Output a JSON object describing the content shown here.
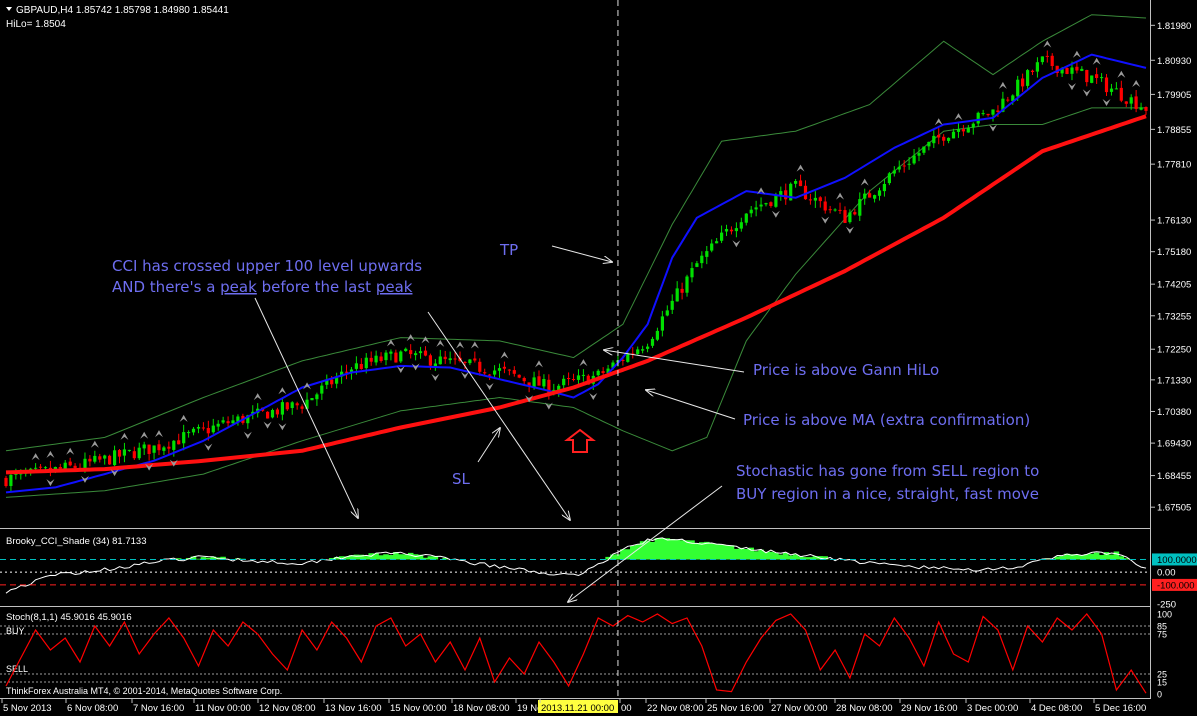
{
  "window": {
    "symbol_line": "GBPAUD,H4  1.85742 1.85798 1.84980 1.85441",
    "hilo_line": "HiLo= 1.8504"
  },
  "colors": {
    "background": "#000000",
    "bull": "#00e000",
    "bear": "#ff0000",
    "hilo": "#1010ff",
    "ma": "#ff1010",
    "bands": "#3a8a3a",
    "annotation": "#6e6ef0",
    "cci_fill": "#33ff33",
    "stoch_line": "#ff0000"
  },
  "chart_data": [
    {
      "type": "candlestick",
      "title": "GBPAUD,H4",
      "ylim": [
        1.67,
        1.822
      ],
      "y_ticks": [
        "1.81980",
        "1.80930",
        "1.79905",
        "1.78855",
        "1.77810",
        "1.76130",
        "1.75180",
        "1.74205",
        "1.73255",
        "1.72250",
        "1.71330",
        "1.70380",
        "1.69430",
        "1.68455",
        "1.67505"
      ],
      "y_tick_values": [
        1.8198,
        1.8093,
        1.79905,
        1.78855,
        1.7781,
        1.7613,
        1.7518,
        1.74205,
        1.73255,
        1.7225,
        1.7133,
        1.7038,
        1.6943,
        1.68455,
        1.67505
      ],
      "candle_count": 232,
      "close_path": [
        [
          0,
          1.6835
        ],
        [
          15,
          1.6875
        ],
        [
          30,
          1.693
        ],
        [
          45,
          1.7005
        ],
        [
          60,
          1.706
        ],
        [
          70,
          1.717
        ],
        [
          80,
          1.721
        ],
        [
          90,
          1.7185
        ],
        [
          100,
          1.716
        ],
        [
          110,
          1.711
        ],
        [
          120,
          1.7145
        ],
        [
          130,
          1.725
        ],
        [
          140,
          1.748
        ],
        [
          150,
          1.764
        ],
        [
          160,
          1.771
        ],
        [
          170,
          1.762
        ],
        [
          180,
          1.776
        ],
        [
          190,
          1.787
        ],
        [
          200,
          1.794
        ],
        [
          210,
          1.809
        ],
        [
          220,
          1.804
        ],
        [
          231,
          1.795
        ]
      ],
      "series": [
        {
          "name": "HiLo",
          "points": [
            [
              0,
              1.6795
            ],
            [
              10,
              1.681
            ],
            [
              20,
              1.685
            ],
            [
              30,
              1.689
            ],
            [
              40,
              1.695
            ],
            [
              50,
              1.703
            ],
            [
              60,
              1.711
            ],
            [
              70,
              1.7155
            ],
            [
              80,
              1.7175
            ],
            [
              90,
              1.717
            ],
            [
              100,
              1.7135
            ],
            [
              110,
              1.71
            ],
            [
              115,
              1.708
            ],
            [
              120,
              1.712
            ],
            [
              125,
              1.72
            ],
            [
              130,
              1.73
            ],
            [
              135,
              1.75
            ],
            [
              140,
              1.762
            ],
            [
              150,
              1.77
            ],
            [
              160,
              1.768
            ],
            [
              170,
              1.774
            ],
            [
              180,
              1.783
            ],
            [
              190,
              1.79
            ],
            [
              200,
              1.792
            ],
            [
              210,
              1.804
            ],
            [
              220,
              1.811
            ],
            [
              231,
              1.807
            ]
          ]
        },
        {
          "name": "MA",
          "points": [
            [
              0,
              1.6855
            ],
            [
              20,
              1.6865
            ],
            [
              40,
              1.689
            ],
            [
              60,
              1.692
            ],
            [
              80,
              1.699
            ],
            [
              100,
              1.705
            ],
            [
              115,
              1.711
            ],
            [
              130,
              1.719
            ],
            [
              150,
              1.732
            ],
            [
              170,
              1.746
            ],
            [
              190,
              1.762
            ],
            [
              210,
              1.782
            ],
            [
              231,
              1.7925
            ]
          ]
        },
        {
          "name": "UpperBand",
          "points": [
            [
              0,
              1.692
            ],
            [
              20,
              1.696
            ],
            [
              40,
              1.708
            ],
            [
              60,
              1.719
            ],
            [
              80,
              1.726
            ],
            [
              100,
              1.725
            ],
            [
              115,
              1.72
            ],
            [
              125,
              1.73
            ],
            [
              135,
              1.76
            ],
            [
              145,
              1.785
            ],
            [
              160,
              1.788
            ],
            [
              175,
              1.796
            ],
            [
              190,
              1.815
            ],
            [
              200,
              1.805
            ],
            [
              210,
              1.815
            ],
            [
              220,
              1.823
            ],
            [
              231,
              1.822
            ]
          ]
        },
        {
          "name": "LowerBand",
          "points": [
            [
              0,
              1.678
            ],
            [
              20,
              1.68
            ],
            [
              40,
              1.685
            ],
            [
              60,
              1.695
            ],
            [
              80,
              1.704
            ],
            [
              100,
              1.708
            ],
            [
              115,
              1.705
            ],
            [
              125,
              1.698
            ],
            [
              135,
              1.692
            ],
            [
              142,
              1.696
            ],
            [
              150,
              1.725
            ],
            [
              160,
              1.745
            ],
            [
              175,
              1.77
            ],
            [
              190,
              1.788
            ],
            [
              200,
              1.79
            ],
            [
              210,
              1.79
            ],
            [
              220,
              1.795
            ],
            [
              231,
              1.795
            ]
          ]
        }
      ],
      "markers_note": "fractal arrows above highs and below lows"
    },
    {
      "type": "area",
      "title": "Brooky_CCI_Shade (34) 81.7133",
      "ylim": [
        -250,
        300
      ],
      "y_ticks": [
        "100.0000",
        "0.00",
        "-100.000",
        "-250"
      ],
      "y_tick_values": [
        100,
        0,
        -100,
        -250
      ],
      "levels": [
        100,
        -100
      ],
      "points": [
        [
          0,
          -150
        ],
        [
          10,
          -20
        ],
        [
          20,
          20
        ],
        [
          30,
          80
        ],
        [
          40,
          120
        ],
        [
          50,
          90
        ],
        [
          60,
          70
        ],
        [
          70,
          130
        ],
        [
          80,
          150
        ],
        [
          90,
          100
        ],
        [
          100,
          40
        ],
        [
          110,
          -10
        ],
        [
          115,
          -30
        ],
        [
          120,
          60
        ],
        [
          125,
          180
        ],
        [
          130,
          250
        ],
        [
          135,
          260
        ],
        [
          145,
          210
        ],
        [
          155,
          160
        ],
        [
          165,
          120
        ],
        [
          175,
          70
        ],
        [
          185,
          40
        ],
        [
          195,
          20
        ],
        [
          205,
          40
        ],
        [
          215,
          140
        ],
        [
          225,
          150
        ],
        [
          231,
          20
        ]
      ]
    },
    {
      "type": "line",
      "title": "Stoch(8,1,1) 45.9016 45.9016",
      "ylim": [
        0,
        100
      ],
      "y_ticks": [
        "100",
        "85",
        "75",
        "25",
        "15",
        "0"
      ],
      "y_tick_values": [
        100,
        85,
        75,
        25,
        15,
        0
      ],
      "levels": [
        85,
        75,
        25,
        15
      ],
      "region_labels": [
        "BUY",
        "SELL"
      ],
      "points": [
        [
          0,
          10
        ],
        [
          3,
          45
        ],
        [
          6,
          80
        ],
        [
          9,
          55
        ],
        [
          12,
          70
        ],
        [
          15,
          40
        ],
        [
          18,
          85
        ],
        [
          21,
          60
        ],
        [
          24,
          90
        ],
        [
          27,
          50
        ],
        [
          30,
          75
        ],
        [
          33,
          95
        ],
        [
          36,
          70
        ],
        [
          39,
          35
        ],
        [
          42,
          80
        ],
        [
          45,
          60
        ],
        [
          48,
          90
        ],
        [
          51,
          75
        ],
        [
          54,
          50
        ],
        [
          57,
          30
        ],
        [
          60,
          80
        ],
        [
          63,
          55
        ],
        [
          66,
          90
        ],
        [
          69,
          70
        ],
        [
          72,
          40
        ],
        [
          75,
          85
        ],
        [
          78,
          95
        ],
        [
          81,
          60
        ],
        [
          84,
          75
        ],
        [
          87,
          40
        ],
        [
          90,
          65
        ],
        [
          93,
          30
        ],
        [
          96,
          70
        ],
        [
          99,
          15
        ],
        [
          102,
          45
        ],
        [
          105,
          25
        ],
        [
          108,
          65
        ],
        [
          111,
          40
        ],
        [
          114,
          10
        ],
        [
          117,
          50
        ],
        [
          120,
          95
        ],
        [
          123,
          85
        ],
        [
          126,
          98
        ],
        [
          129,
          90
        ],
        [
          132,
          100
        ],
        [
          135,
          88
        ],
        [
          138,
          95
        ],
        [
          141,
          60
        ],
        [
          144,
          5
        ],
        [
          147,
          3
        ],
        [
          150,
          40
        ],
        [
          153,
          70
        ],
        [
          156,
          92
        ],
        [
          159,
          100
        ],
        [
          162,
          80
        ],
        [
          165,
          30
        ],
        [
          168,
          55
        ],
        [
          171,
          20
        ],
        [
          174,
          75
        ],
        [
          177,
          60
        ],
        [
          180,
          95
        ],
        [
          183,
          70
        ],
        [
          186,
          35
        ],
        [
          189,
          90
        ],
        [
          192,
          50
        ],
        [
          195,
          40
        ],
        [
          198,
          97
        ],
        [
          201,
          80
        ],
        [
          204,
          30
        ],
        [
          207,
          85
        ],
        [
          210,
          65
        ],
        [
          213,
          95
        ],
        [
          216,
          80
        ],
        [
          219,
          100
        ],
        [
          222,
          75
        ],
        [
          225,
          5
        ],
        [
          228,
          30
        ],
        [
          231,
          1
        ]
      ]
    }
  ],
  "time_axis": {
    "labels": [
      "5 Nov 2013",
      "6 Nov 08:00",
      "7 Nov 16:00",
      "11 Nov 00:00",
      "12 Nov 08:00",
      "13 Nov 16:00",
      "15 Nov 00:00",
      "18 Nov 08:00",
      "19 Ne",
      "2013.11.21 00:00",
      "00",
      "22 Nov 08:00",
      "25 Nov 16:00",
      "27 Nov 00:00",
      "28 Nov 08:00",
      "29 Nov 16:00",
      "3 Dec 00:00",
      "4 Dec 08:00",
      "5 Dec 16:00"
    ],
    "highlight": "2013.11.21 00:00",
    "crosshair_index": 124
  },
  "annotations": {
    "cci_text_1": "CCI has crossed upper 100 level upwards",
    "cci_text_2a": "AND there's a ",
    "cci_text_2b": "peak",
    "cci_text_2c": " before the last ",
    "cci_text_2d": "peak",
    "tp": "TP",
    "sl": "SL",
    "price_hilo": "Price is above Gann HiLo",
    "price_ma": "Price is above MA (extra confirmation)",
    "stoch_text_1": "Stochastic has gone from SELL region to",
    "stoch_text_2": "BUY region in a nice, straight, fast move"
  },
  "footer": {
    "copyright": "ThinkForex Australia MT4, © 2001-2014, MetaQuotes Software Corp."
  }
}
